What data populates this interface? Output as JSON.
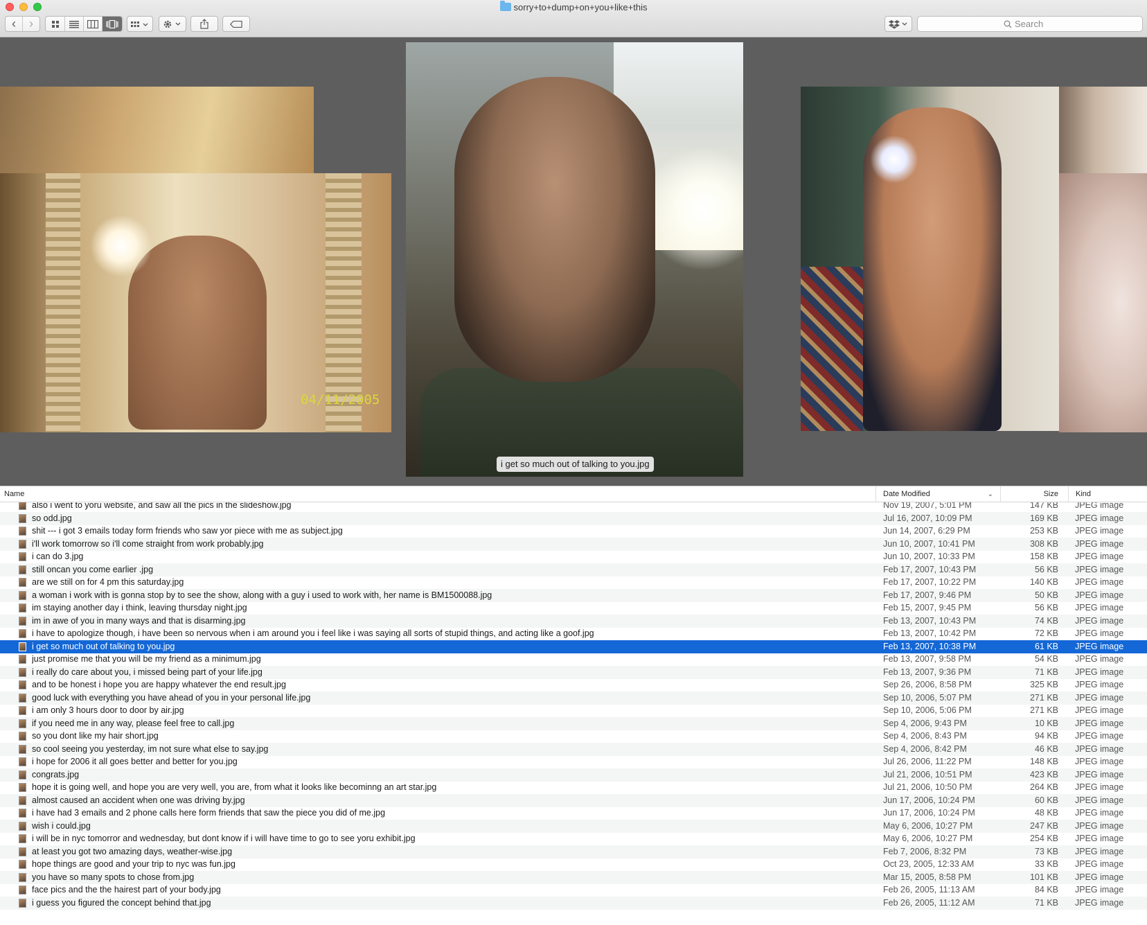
{
  "window": {
    "title": "sorry+to+dump+on+you+like+this"
  },
  "toolbar": {
    "back_glyph": "‹",
    "forward_glyph": "›",
    "view_icons": [
      "icon-view",
      "list-view",
      "column-view",
      "cover-flow-view"
    ],
    "arrange_icon": "arrange-grid-icon",
    "action_icon": "gear-icon",
    "share_icon": "share-icon",
    "tag_icon": "tag-icon",
    "dropbox_icon": "dropbox-icon",
    "search_placeholder": "Search"
  },
  "coverflow": {
    "caption": "i get so much out of talking to you.jpg",
    "date_stamp": "04/11/2005"
  },
  "list": {
    "headers": {
      "name": "Name",
      "date": "Date Modified",
      "size": "Size",
      "kind": "Kind"
    },
    "rows": [
      {
        "name": "also i went to yoru website, and saw all the pics in the slideshow.jpg",
        "date": "Nov 19, 2007, 5:01 PM",
        "size": "147 KB",
        "kind": "JPEG image"
      },
      {
        "name": "so odd.jpg",
        "date": "Jul 16, 2007, 10:09 PM",
        "size": "169 KB",
        "kind": "JPEG image"
      },
      {
        "name": "shit --- i got 3 emails today form friends who saw yor piece with me as subject.jpg",
        "date": "Jun 14, 2007, 6:29 PM",
        "size": "253 KB",
        "kind": "JPEG image"
      },
      {
        "name": "i'll work tomorrow so i'll come straight from work probably.jpg",
        "date": "Jun 10, 2007, 10:41 PM",
        "size": "308 KB",
        "kind": "JPEG image"
      },
      {
        "name": "i can do 3.jpg",
        "date": "Jun 10, 2007, 10:33 PM",
        "size": "158 KB",
        "kind": "JPEG image"
      },
      {
        "name": "still oncan you come earlier .jpg",
        "date": "Feb 17, 2007, 10:43 PM",
        "size": "56 KB",
        "kind": "JPEG image"
      },
      {
        "name": "are we still on for 4 pm this saturday.jpg",
        "date": "Feb 17, 2007, 10:22 PM",
        "size": "140 KB",
        "kind": "JPEG image"
      },
      {
        "name": "a woman i work with is gonna stop by to see the show, along with a guy i used to work with, her name is BM1500088.jpg",
        "date": "Feb 17, 2007, 9:46 PM",
        "size": "50 KB",
        "kind": "JPEG image"
      },
      {
        "name": "im staying another day i think, leaving thursday night.jpg",
        "date": "Feb 15, 2007, 9:45 PM",
        "size": "56 KB",
        "kind": "JPEG image"
      },
      {
        "name": "im in awe of you in many ways and that is disarming.jpg",
        "date": "Feb 13, 2007, 10:43 PM",
        "size": "74 KB",
        "kind": "JPEG image"
      },
      {
        "name": "i have to apologize though, i have been so nervous when i am around you i feel like i was saying all sorts of stupid things, and acting like a goof.jpg",
        "date": "Feb 13, 2007, 10:42 PM",
        "size": "72 KB",
        "kind": "JPEG image"
      },
      {
        "name": "i get so much out of talking to you.jpg",
        "date": "Feb 13, 2007, 10:38 PM",
        "size": "61 KB",
        "kind": "JPEG image",
        "selected": true
      },
      {
        "name": "just promise me that you will be my friend as a minimum.jpg",
        "date": "Feb 13, 2007, 9:58 PM",
        "size": "54 KB",
        "kind": "JPEG image"
      },
      {
        "name": "i really do care about you, i missed being part of your life.jpg",
        "date": "Feb 13, 2007, 9:36 PM",
        "size": "71 KB",
        "kind": "JPEG image"
      },
      {
        "name": "and to be honest i hope you are happy whatever the end result.jpg",
        "date": "Sep 26, 2006, 8:58 PM",
        "size": "325 KB",
        "kind": "JPEG image"
      },
      {
        "name": "good luck with everything you have ahead of you in your personal life.jpg",
        "date": "Sep 10, 2006, 5:07 PM",
        "size": "271 KB",
        "kind": "JPEG image"
      },
      {
        "name": "i am only 3 hours door to door by air.jpg",
        "date": "Sep 10, 2006, 5:06 PM",
        "size": "271 KB",
        "kind": "JPEG image"
      },
      {
        "name": "if you need me in any way, please feel free to call.jpg",
        "date": "Sep 4, 2006, 9:43 PM",
        "size": "10 KB",
        "kind": "JPEG image"
      },
      {
        "name": "so you dont like my hair short.jpg",
        "date": "Sep 4, 2006, 8:43 PM",
        "size": "94 KB",
        "kind": "JPEG image"
      },
      {
        "name": "so cool seeing you yesterday, im not sure what else to say.jpg",
        "date": "Sep 4, 2006, 8:42 PM",
        "size": "46 KB",
        "kind": "JPEG image"
      },
      {
        "name": "i hope for 2006 it all goes better and better for you.jpg",
        "date": "Jul 26, 2006, 11:22 PM",
        "size": "148 KB",
        "kind": "JPEG image"
      },
      {
        "name": "congrats.jpg",
        "date": "Jul 21, 2006, 10:51 PM",
        "size": "423 KB",
        "kind": "JPEG image"
      },
      {
        "name": "hope it is going well, and hope you are very well, you are, from what it looks like becominng an art star.jpg",
        "date": "Jul 21, 2006, 10:50 PM",
        "size": "264 KB",
        "kind": "JPEG image"
      },
      {
        "name": "almost caused an accident when one was driving by.jpg",
        "date": "Jun 17, 2006, 10:24 PM",
        "size": "60 KB",
        "kind": "JPEG image"
      },
      {
        "name": "i have had 3 emails and 2 phone calls here form friends that saw the piece you did of me.jpg",
        "date": "Jun 17, 2006, 10:24 PM",
        "size": "48 KB",
        "kind": "JPEG image"
      },
      {
        "name": "wish i could.jpg",
        "date": "May 6, 2006, 10:27 PM",
        "size": "247 KB",
        "kind": "JPEG image"
      },
      {
        "name": "i will be in nyc tomorror and wednesday, but dont know if i will have time to go to see yoru exhibit.jpg",
        "date": "May 6, 2006, 10:27 PM",
        "size": "254 KB",
        "kind": "JPEG image"
      },
      {
        "name": "at least you got two amazing days, weather-wise.jpg",
        "date": "Feb 7, 2006, 8:32 PM",
        "size": "73 KB",
        "kind": "JPEG image"
      },
      {
        "name": "hope things are good and your trip to nyc was fun.jpg",
        "date": "Oct 23, 2005, 12:33 AM",
        "size": "33 KB",
        "kind": "JPEG image"
      },
      {
        "name": "you have so many spots to chose from.jpg",
        "date": "Mar 15, 2005, 8:58 PM",
        "size": "101 KB",
        "kind": "JPEG image"
      },
      {
        "name": "face pics and the the hairest part of your body.jpg",
        "date": "Feb 26, 2005, 11:13 AM",
        "size": "84 KB",
        "kind": "JPEG image"
      },
      {
        "name": "i guess you figured the concept behind that.jpg",
        "date": "Feb 26, 2005, 11:12 AM",
        "size": "71 KB",
        "kind": "JPEG image"
      }
    ]
  }
}
